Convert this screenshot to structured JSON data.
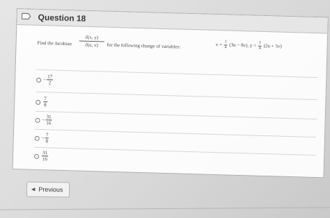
{
  "question": {
    "title": "Question 18",
    "prompt_left": "Find the Jacobian",
    "jacobian_num": "∂(x, y)",
    "jacobian_den": "∂(u, v)",
    "prompt_right": "for the following change of variables:",
    "eq_x_lhs": "x =",
    "eq_x_coef_num": "1",
    "eq_x_coef_den": "4",
    "eq_x_rhs": "(3u − 8v),",
    "eq_y_lhs": "y =",
    "eq_y_coef_num": "1",
    "eq_y_coef_den": "4",
    "eq_y_rhs": "(2u + 5v)"
  },
  "options": [
    {
      "sign": "−",
      "num": "17",
      "den": "2"
    },
    {
      "sign": "",
      "num": "7",
      "den": "8"
    },
    {
      "sign": "−",
      "num": "31",
      "den": "16"
    },
    {
      "sign": "−",
      "num": "7",
      "den": "8"
    },
    {
      "sign": "",
      "num": "31",
      "den": "16"
    }
  ],
  "navigation": {
    "previous_label": "Previous",
    "previous_icon": "chevron-left-icon"
  },
  "colors": {
    "flag": "#ffffff",
    "flag_stroke": "#555555"
  }
}
